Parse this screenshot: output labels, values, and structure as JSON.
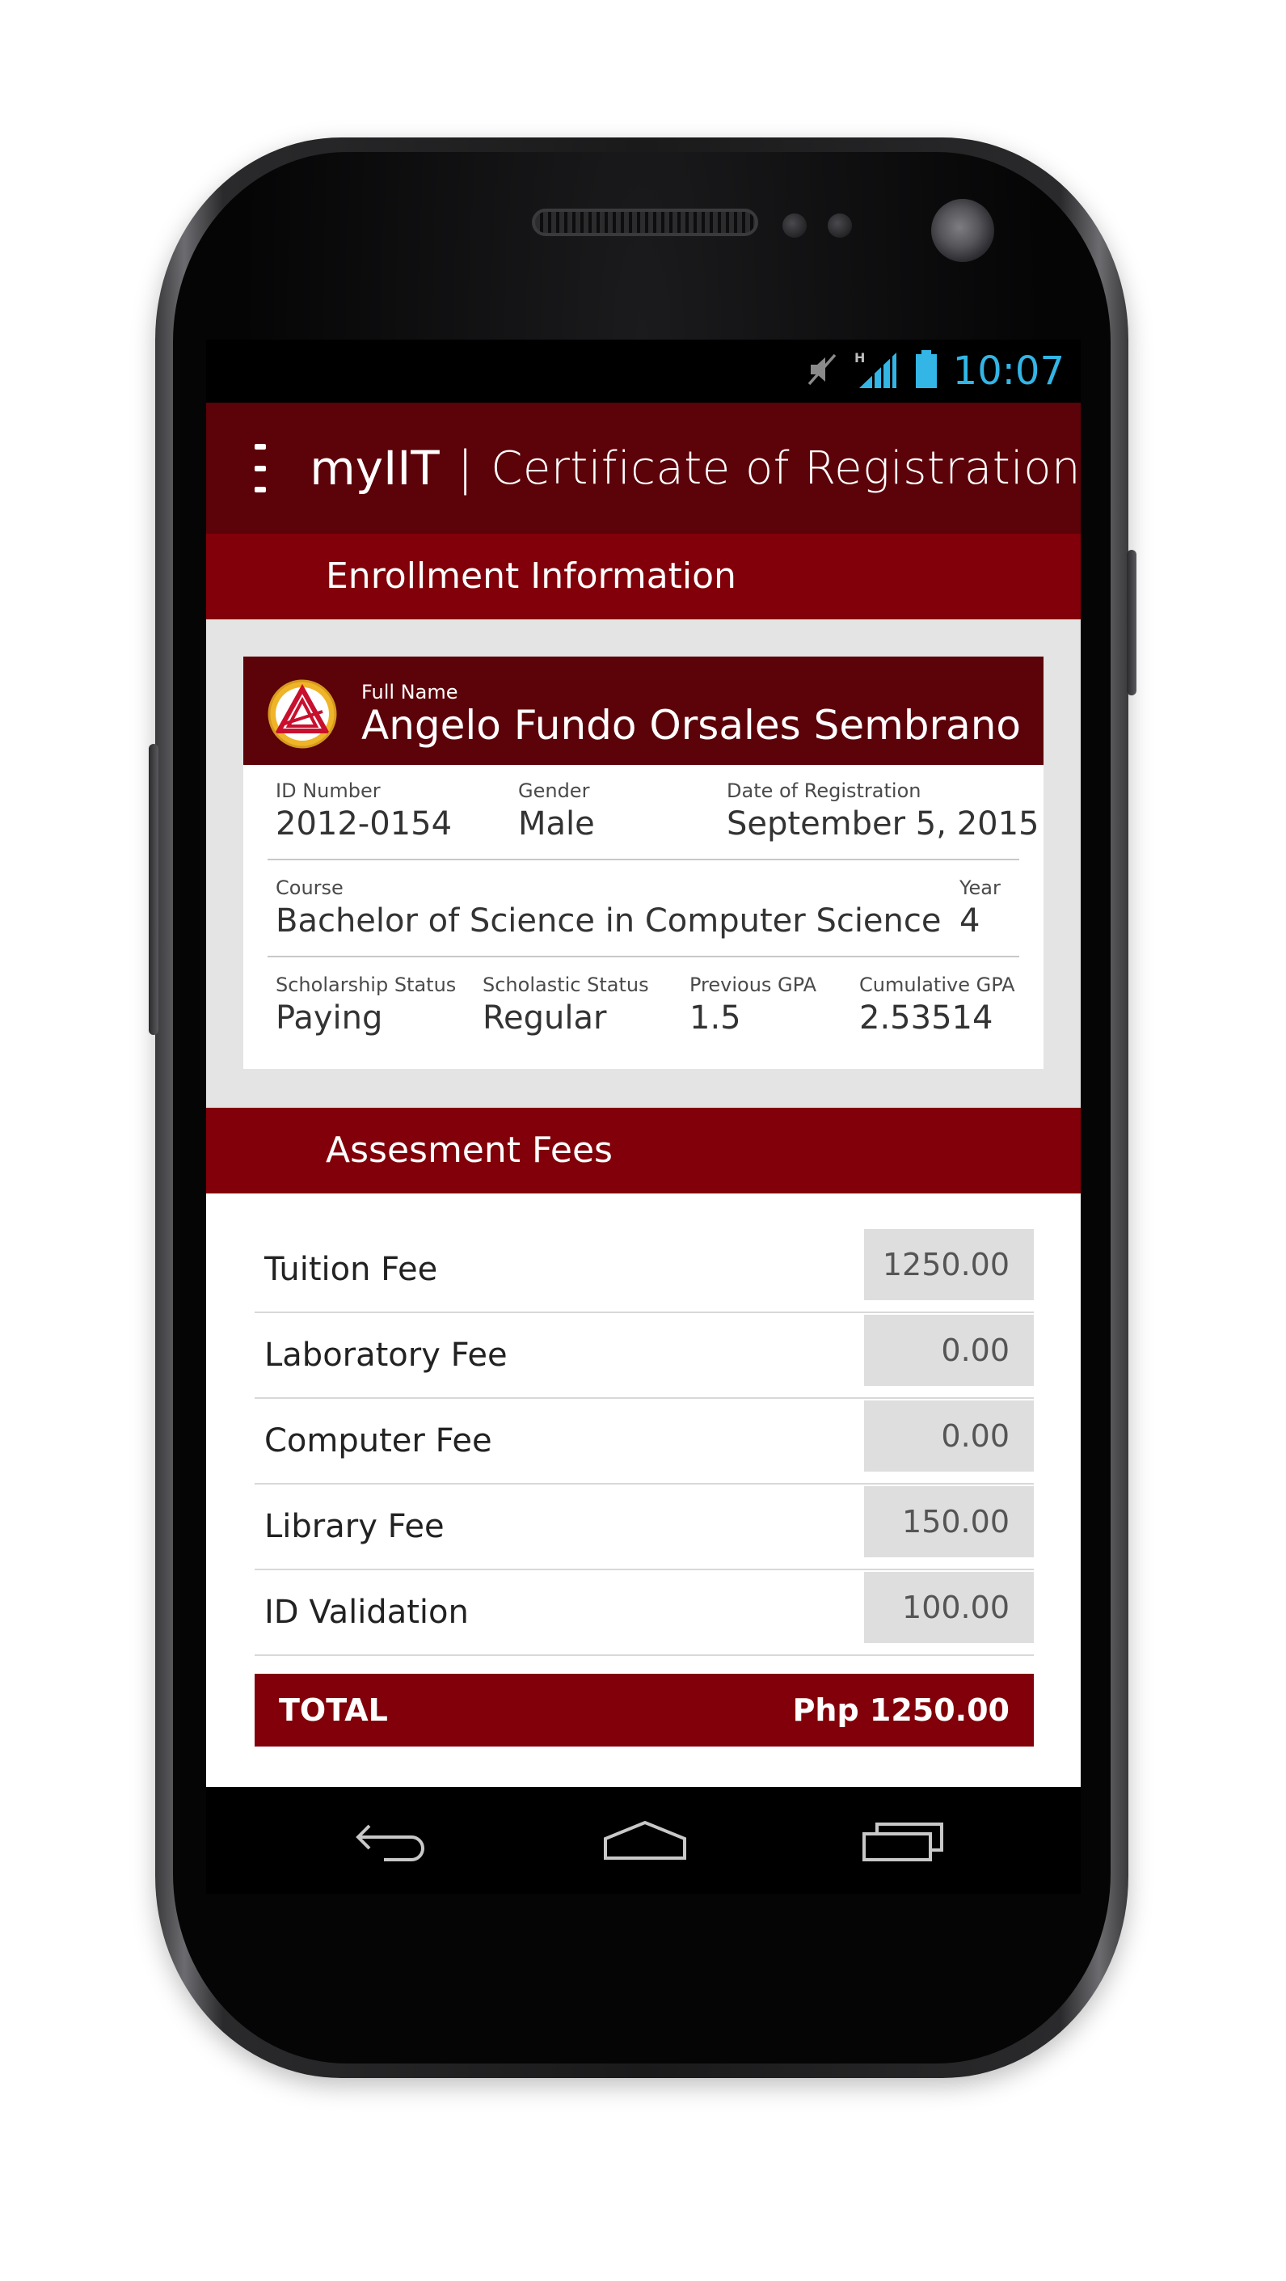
{
  "statusbar": {
    "time": "10:07",
    "icons": [
      "mute-icon",
      "signal-h-icon",
      "battery-icon"
    ],
    "time_color": "#33b5e5"
  },
  "appbar": {
    "brand": "myIIT",
    "separator": "|",
    "page_title": "Certificate of Registration",
    "menu_icon": "hamburger-menu-icon",
    "background": "#5c0209"
  },
  "enrollment": {
    "section_title": "Enrollment Information",
    "full_name_label": "Full Name",
    "full_name": "Angelo Fundo Orsales Sembrano",
    "id_number_label": "ID Number",
    "id_number": "2012-0154",
    "gender_label": "Gender",
    "gender": "Male",
    "date_label": "Date of Registration",
    "date": "September 5, 2015",
    "course_label": "Course",
    "course": "Bachelor of Science in Computer Science",
    "year_label": "Year",
    "year": "4",
    "scholarship_label": "Scholarship Status",
    "scholarship": "Paying",
    "scholastic_label": "Scholastic Status",
    "scholastic": "Regular",
    "prev_gpa_label": "Previous GPA",
    "prev_gpa": "1.5",
    "cum_gpa_label": "Cumulative GPA",
    "cum_gpa": "2.53514"
  },
  "fees": {
    "section_title": "Assesment Fees",
    "items": [
      {
        "name": "Tuition Fee",
        "amount": "1250.00"
      },
      {
        "name": "Laboratory Fee",
        "amount": "0.00"
      },
      {
        "name": "Computer Fee",
        "amount": "0.00"
      },
      {
        "name": "Library Fee",
        "amount": "150.00"
      },
      {
        "name": "ID Validation",
        "amount": "100.00"
      }
    ],
    "total_label": "TOTAL",
    "total_value": "Php 1250.00",
    "accent": "#820009"
  },
  "navbar": {
    "icons": [
      "back-icon",
      "home-icon",
      "recent-apps-icon"
    ]
  }
}
